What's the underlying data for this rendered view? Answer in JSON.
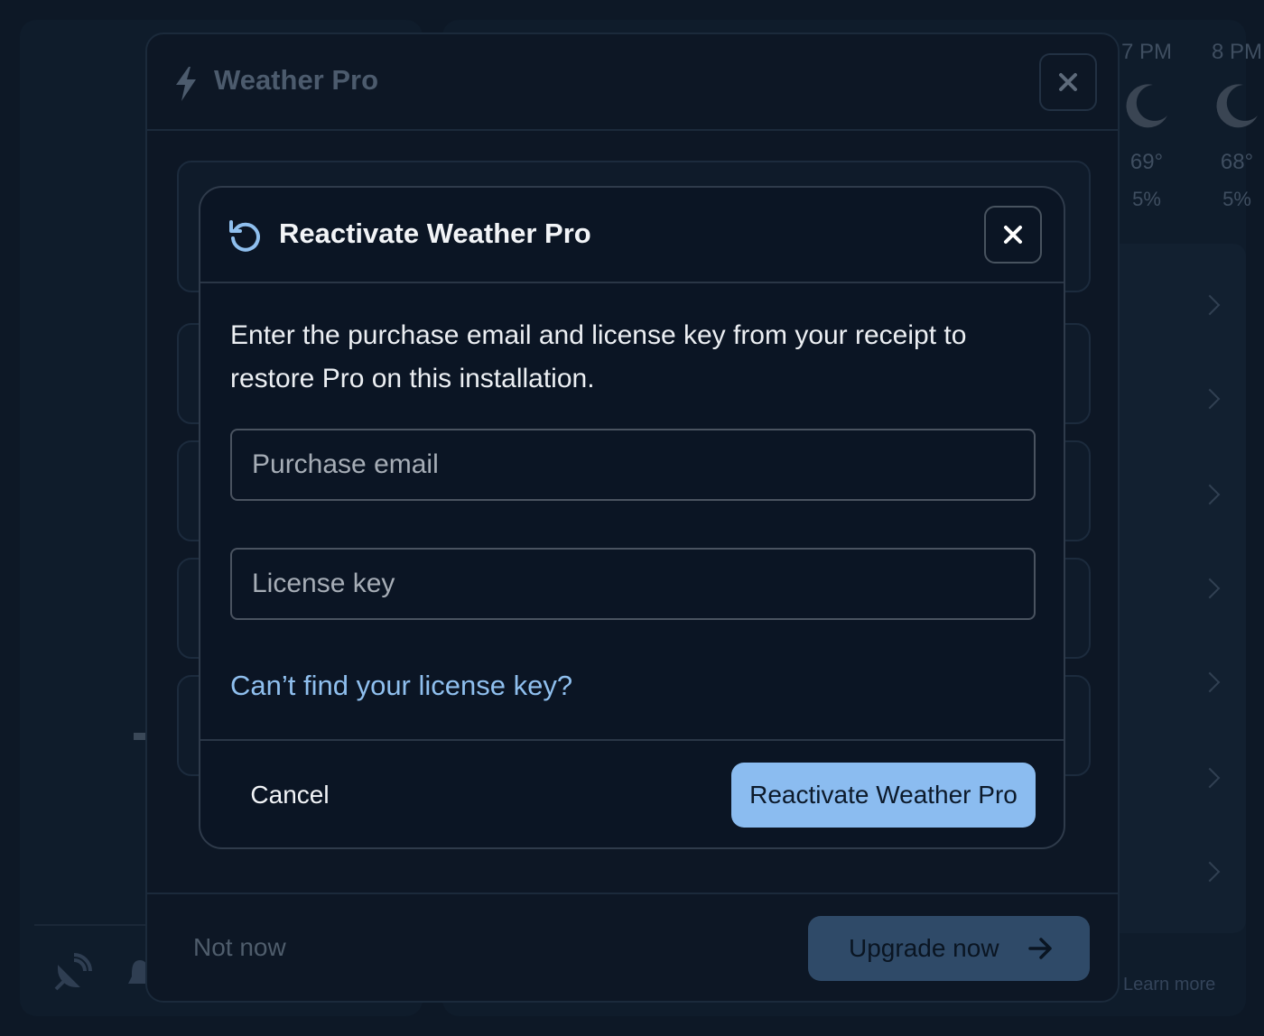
{
  "background": {
    "hours": [
      {
        "time": "7 PM",
        "temp": "69°",
        "precip": "5%"
      },
      {
        "time": "8 PM",
        "temp": "68°",
        "precip": "5%"
      }
    ],
    "learn_more": "Learn more"
  },
  "outer_modal": {
    "title": "Weather Pro",
    "not_now": "Not now",
    "upgrade": "Upgrade now"
  },
  "dialog": {
    "title": "Reactivate Weather Pro",
    "description": "Enter the purchase email and license key from your receipt to restore Pro on this installation.",
    "email_placeholder": "Purchase email",
    "email_value": "",
    "key_placeholder": "License key",
    "key_value": "",
    "help_link": "Can’t find your license key?",
    "cancel": "Cancel",
    "submit": "Reactivate Weather Pro"
  },
  "colors": {
    "accent": "#8bbcf0",
    "link": "#8fbfee",
    "dialog_bg": "#0b1524",
    "backdrop": "#0d1826"
  }
}
